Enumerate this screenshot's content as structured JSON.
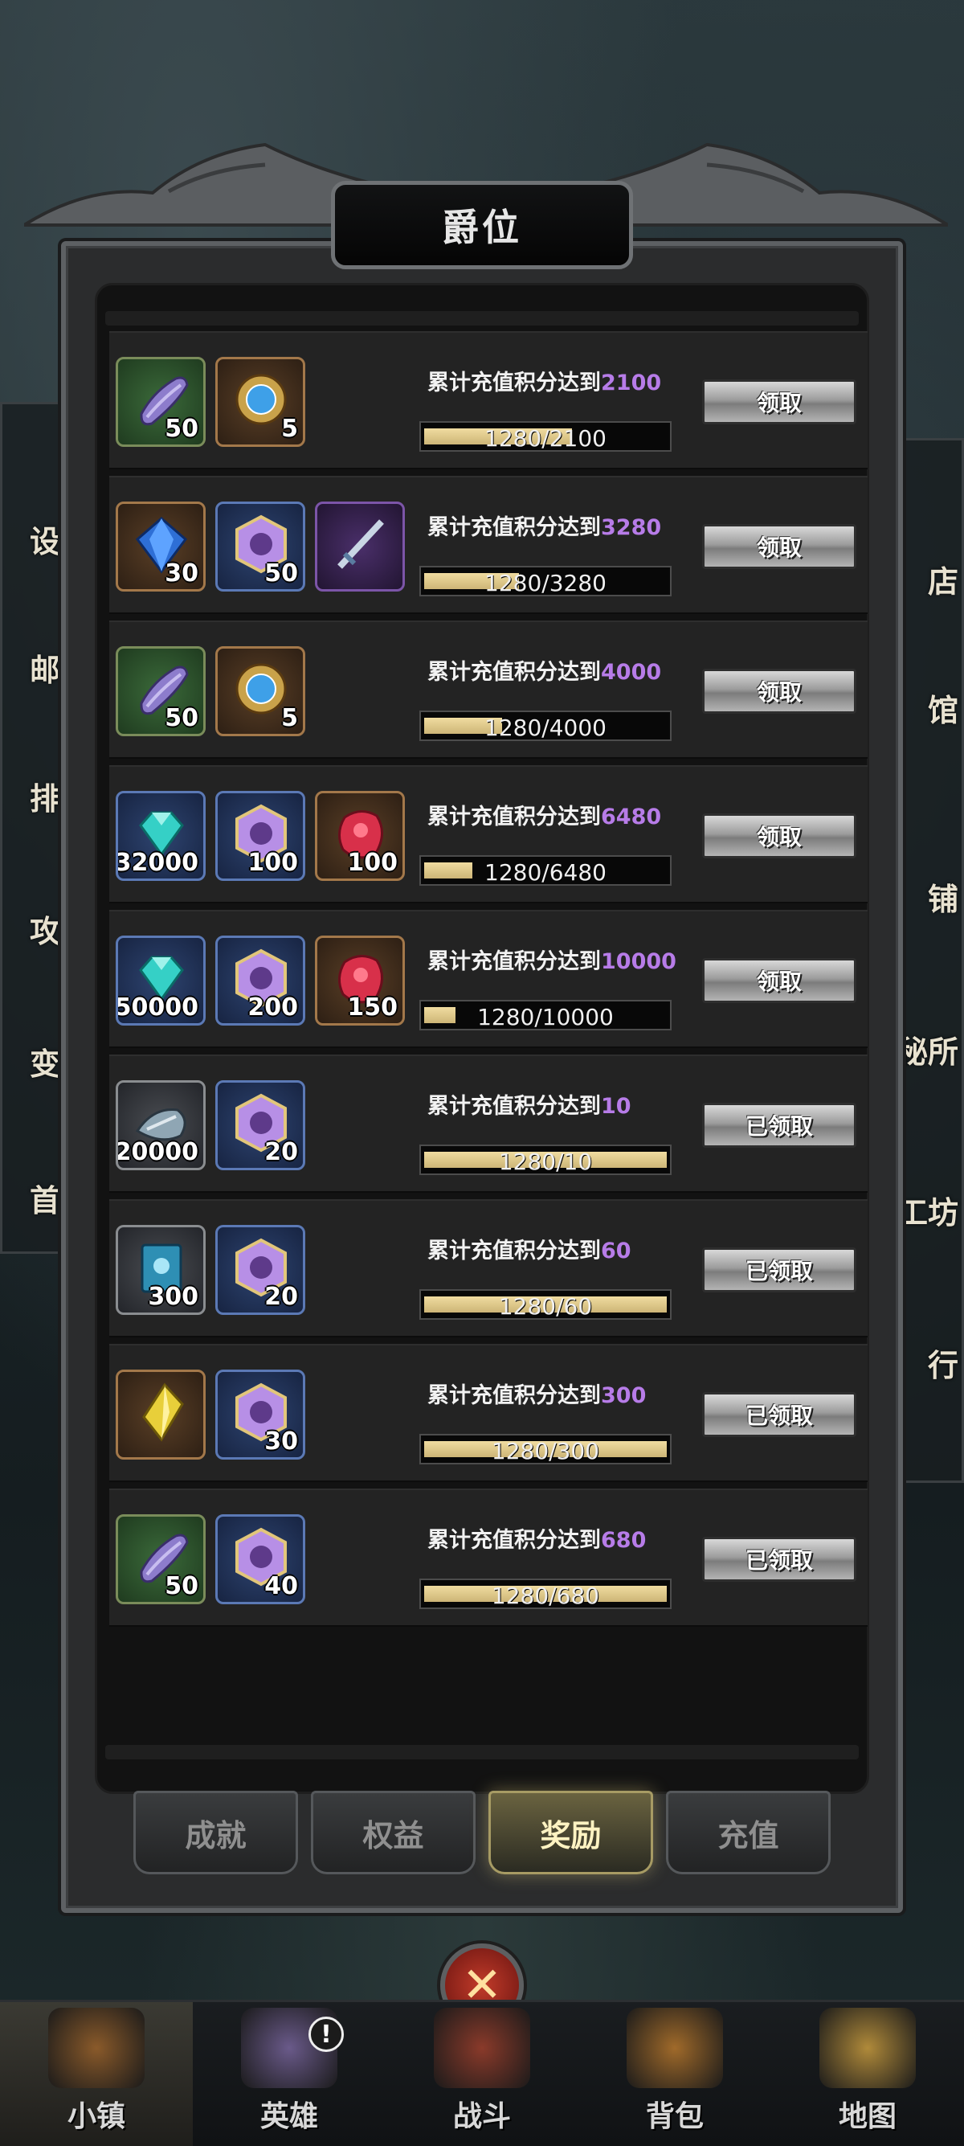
{
  "title": "爵位",
  "side_left_labels": [
    "设",
    "邮",
    "排",
    "攻",
    "变",
    "首"
  ],
  "side_right_labels": [
    "店",
    "馆",
    "铺",
    "秘所",
    "工坊",
    "行"
  ],
  "rows": [
    {
      "requirement_prefix": "累计充值积分达到",
      "requirement_value": "2100",
      "progress_text": "1280/2100",
      "progress": 0.61,
      "button_label": "领取",
      "items": [
        {
          "icon": "scroll-icon",
          "bg": "green",
          "count": "50"
        },
        {
          "icon": "gear-crystal-icon",
          "bg": "orange",
          "count": "5"
        }
      ]
    },
    {
      "requirement_prefix": "累计充值积分达到",
      "requirement_value": "3280",
      "progress_text": "1280/3280",
      "progress": 0.39,
      "button_label": "领取",
      "items": [
        {
          "icon": "diamond-icon",
          "bg": "orange",
          "count": "30"
        },
        {
          "icon": "hero-badge-icon",
          "bg": "blue",
          "count": "50"
        },
        {
          "icon": "sword-icon",
          "bg": "purple",
          "count": ""
        }
      ]
    },
    {
      "requirement_prefix": "累计充值积分达到",
      "requirement_value": "4000",
      "progress_text": "1280/4000",
      "progress": 0.32,
      "button_label": "领取",
      "items": [
        {
          "icon": "scroll-icon",
          "bg": "green",
          "count": "50"
        },
        {
          "icon": "gear-crystal-icon",
          "bg": "orange",
          "count": "5"
        }
      ]
    },
    {
      "requirement_prefix": "累计充值积分达到",
      "requirement_value": "6480",
      "progress_text": "1280/6480",
      "progress": 0.2,
      "button_label": "领取",
      "items": [
        {
          "icon": "gem-icon",
          "bg": "blue",
          "count": "32000"
        },
        {
          "icon": "hero-badge-icon",
          "bg": "blue",
          "count": "100"
        },
        {
          "icon": "red-ore-icon",
          "bg": "orange",
          "count": "100"
        }
      ]
    },
    {
      "requirement_prefix": "累计充值积分达到",
      "requirement_value": "10000",
      "progress_text": "1280/10000",
      "progress": 0.13,
      "button_label": "领取",
      "items": [
        {
          "icon": "gem-icon",
          "bg": "blue",
          "count": "50000"
        },
        {
          "icon": "hero-badge-icon",
          "bg": "blue",
          "count": "200"
        },
        {
          "icon": "red-ore-icon",
          "bg": "orange",
          "count": "150"
        }
      ]
    },
    {
      "requirement_prefix": "累计充值积分达到",
      "requirement_value": "10",
      "progress_text": "1280/10",
      "progress": 1.0,
      "button_label": "已领取",
      "items": [
        {
          "icon": "iron-ore-icon",
          "bg": "gray",
          "count": "20000"
        },
        {
          "icon": "hero-badge-icon",
          "bg": "blue",
          "count": "20"
        }
      ]
    },
    {
      "requirement_prefix": "累计充值积分达到",
      "requirement_value": "60",
      "progress_text": "1280/60",
      "progress": 1.0,
      "button_label": "已领取",
      "items": [
        {
          "icon": "blue-book-icon",
          "bg": "gray",
          "count": "300"
        },
        {
          "icon": "hero-badge-icon",
          "bg": "blue",
          "count": "20"
        }
      ]
    },
    {
      "requirement_prefix": "累计充值积分达到",
      "requirement_value": "300",
      "progress_text": "1280/300",
      "progress": 1.0,
      "button_label": "已领取",
      "items": [
        {
          "icon": "gold-shard-icon",
          "bg": "orange",
          "count": ""
        },
        {
          "icon": "hero-badge-icon",
          "bg": "blue",
          "count": "30"
        }
      ]
    },
    {
      "requirement_prefix": "累计充值积分达到",
      "requirement_value": "680",
      "progress_text": "1280/680",
      "progress": 1.0,
      "button_label": "已领取",
      "items": [
        {
          "icon": "scroll-icon",
          "bg": "green",
          "count": "50"
        },
        {
          "icon": "hero-badge-icon",
          "bg": "blue",
          "count": "40"
        }
      ]
    }
  ],
  "tabs": [
    {
      "label": "成就",
      "active": false
    },
    {
      "label": "权益",
      "active": false
    },
    {
      "label": "奖励",
      "active": true
    },
    {
      "label": "充值",
      "active": false
    }
  ],
  "nav": [
    {
      "label": "小镇",
      "icon": "town-icon",
      "active": true,
      "badge": ""
    },
    {
      "label": "英雄",
      "icon": "hero-icon",
      "active": false,
      "badge": "!"
    },
    {
      "label": "战斗",
      "icon": "battle-icon",
      "active": false,
      "badge": ""
    },
    {
      "label": "背包",
      "icon": "backpack-icon",
      "active": false,
      "badge": ""
    },
    {
      "label": "地图",
      "icon": "map-icon",
      "active": false,
      "badge": ""
    }
  ],
  "colors": {
    "accent_purple": "#b77ce8",
    "bar_fill": "#e3cc8a",
    "active_tab": "#fff3c2"
  }
}
